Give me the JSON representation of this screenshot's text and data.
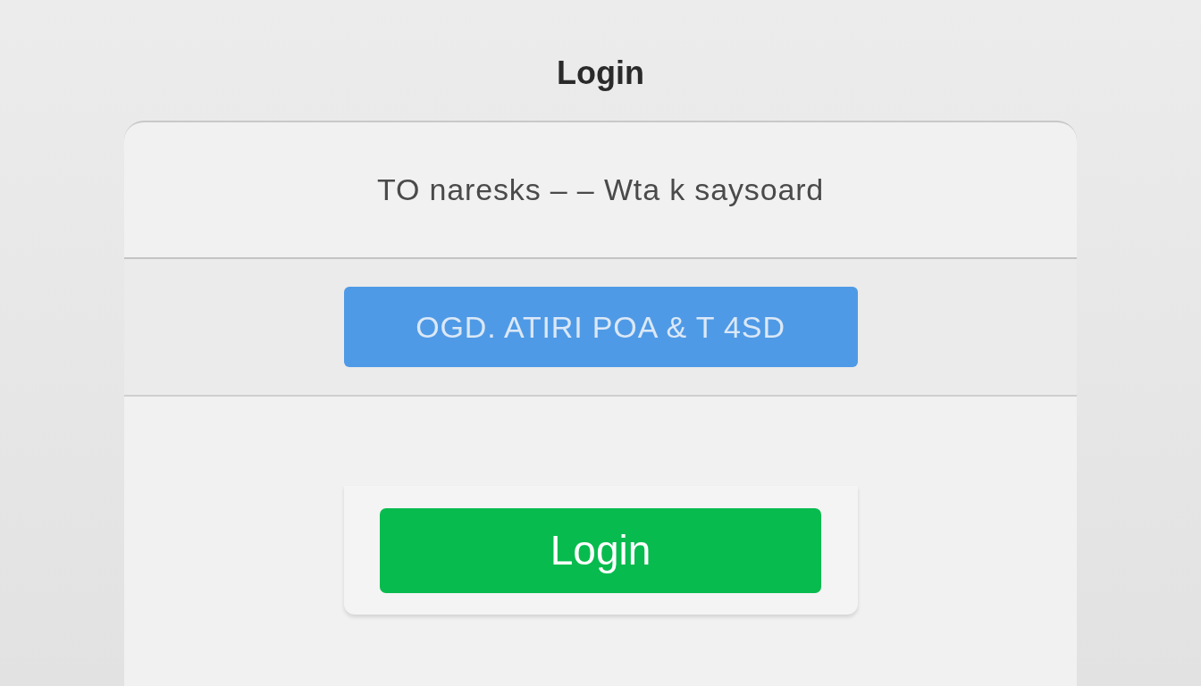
{
  "title": "Login",
  "form": {
    "instruction": "TO naresks –  – Wta k saysoard",
    "secondary_button": "OGD. ATIRI POA & T 4SD",
    "login_button": "Login"
  }
}
